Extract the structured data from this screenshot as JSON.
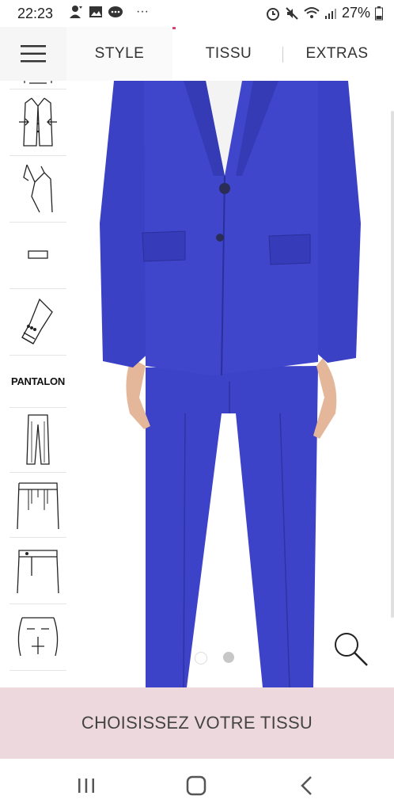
{
  "status": {
    "time": "22:23",
    "ellipsis": "···",
    "battery": "27%"
  },
  "tabs": [
    {
      "label": "STYLE"
    },
    {
      "label": "TISSU"
    },
    {
      "label": "EXTRAS"
    }
  ],
  "sidebar": {
    "items": [
      {
        "icon": "jacket-partial-icon"
      },
      {
        "icon": "jacket-fitted-icon"
      },
      {
        "icon": "lapel-icon"
      },
      {
        "icon": "pocket-flap-icon"
      },
      {
        "icon": "sleeve-buttons-icon"
      },
      {
        "label": "PANTALON"
      },
      {
        "icon": "trousers-icon"
      },
      {
        "icon": "trouser-pleats-icon"
      },
      {
        "icon": "waistband-icon"
      },
      {
        "icon": "back-pockets-icon"
      }
    ]
  },
  "carousel": {
    "total_images": 2,
    "active_index": 0
  },
  "cta": {
    "label": "CHOISISSEZ VOTRE TISSU"
  },
  "colors": {
    "accent": "#d2447a",
    "suit": "#3d43c9",
    "cta_bg": "#edd8dd"
  }
}
